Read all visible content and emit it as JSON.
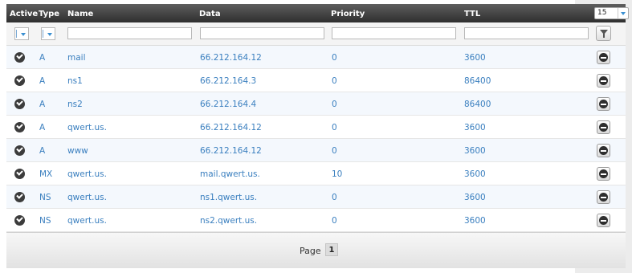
{
  "header": {
    "active": "Active",
    "type": "Type",
    "name": "Name",
    "data": "Data",
    "priority": "Priority",
    "ttl": "TTL",
    "page_size": "15"
  },
  "rows": [
    {
      "type": "A",
      "name": "mail",
      "data": "66.212.164.12",
      "priority": "0",
      "ttl": "3600"
    },
    {
      "type": "A",
      "name": "ns1",
      "data": "66.212.164.3",
      "priority": "0",
      "ttl": "86400"
    },
    {
      "type": "A",
      "name": "ns2",
      "data": "66.212.164.4",
      "priority": "0",
      "ttl": "86400"
    },
    {
      "type": "A",
      "name": "qwert.us.",
      "data": "66.212.164.12",
      "priority": "0",
      "ttl": "3600"
    },
    {
      "type": "A",
      "name": "www",
      "data": "66.212.164.12",
      "priority": "0",
      "ttl": "3600"
    },
    {
      "type": "MX",
      "name": "qwert.us.",
      "data": "mail.qwert.us.",
      "priority": "10",
      "ttl": "3600"
    },
    {
      "type": "NS",
      "name": "qwert.us.",
      "data": "ns1.qwert.us.",
      "priority": "0",
      "ttl": "3600"
    },
    {
      "type": "NS",
      "name": "qwert.us.",
      "data": "ns2.qwert.us.",
      "priority": "0",
      "ttl": "3600"
    }
  ],
  "pager": {
    "label": "Page",
    "current": "1"
  },
  "colors": {
    "link": "#3a7fbf",
    "header": "#3a3a3a",
    "row_alt": "#f4f8fd"
  }
}
